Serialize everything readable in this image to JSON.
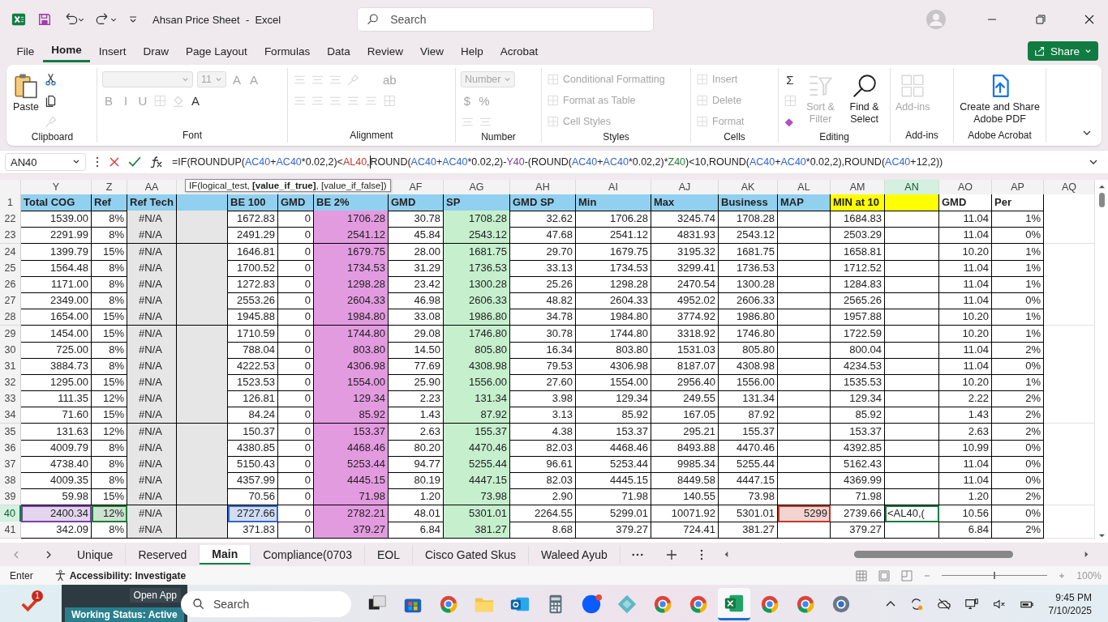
{
  "window": {
    "title": "Ahsan Price Sheet  -  Excel"
  },
  "search": {
    "placeholder": "Search"
  },
  "share": {
    "label": "Share"
  },
  "menu": [
    {
      "label": "File",
      "selected": false
    },
    {
      "label": "Home",
      "selected": true
    },
    {
      "label": "Insert",
      "selected": false
    },
    {
      "label": "Draw",
      "selected": false
    },
    {
      "label": "Page Layout",
      "selected": false
    },
    {
      "label": "Formulas",
      "selected": false
    },
    {
      "label": "Data",
      "selected": false
    },
    {
      "label": "Review",
      "selected": false
    },
    {
      "label": "View",
      "selected": false
    },
    {
      "label": "Help",
      "selected": false
    },
    {
      "label": "Acrobat",
      "selected": false
    }
  ],
  "ribbon": {
    "groups": [
      {
        "label": "Clipboard",
        "blocks": [
          {
            "kind": "clipboard",
            "label": "Paste",
            "disabled": false
          },
          {
            "kind": "stack",
            "lines": [
              [
                {
                  "kind": "scissors",
                  "disabled": false
                }
              ],
              [
                {
                  "kind": "pages",
                  "disabled": false
                }
              ],
              [
                {
                  "kind": "brush",
                  "disabled": true
                }
              ]
            ]
          }
        ]
      },
      {
        "label": "Font",
        "blocks": [
          {
            "kind": "stack",
            "lines": [
              [
                {
                  "kind": "field",
                  "disabled": true
                },
                {
                  "kind": "field",
                  "value": "11",
                  "disabled": true
                },
                {
                  "kind": "glyph",
                  "label": "A",
                  "disabled": true
                },
                {
                  "kind": "glyph",
                  "label": "A",
                  "disabled": true
                }
              ],
              [
                {
                  "kind": "glyph",
                  "label": "B",
                  "disabled": true
                },
                {
                  "kind": "glyph",
                  "label": "I",
                  "disabled": true
                },
                {
                  "kind": "glyph",
                  "label": "U",
                  "disabled": true
                },
                {
                  "kind": "grid",
                  "disabled": true
                },
                {
                  "kind": "bucket",
                  "disabled": true
                },
                {
                  "kind": "glyph",
                  "label": "A",
                  "disabled": false
                }
              ]
            ]
          }
        ]
      },
      {
        "label": "Alignment",
        "blocks": [
          {
            "kind": "stack",
            "lines": [
              [
                {
                  "kind": "lines",
                  "disabled": true
                },
                {
                  "kind": "lines",
                  "disabled": true
                },
                {
                  "kind": "lines",
                  "disabled": true
                },
                {
                  "kind": "brush",
                  "disabled": true
                }
              ],
              [
                {
                  "kind": "lines",
                  "disabled": true
                },
                {
                  "kind": "lines",
                  "disabled": true
                },
                {
                  "kind": "lines",
                  "disabled": true
                },
                {
                  "kind": "lines",
                  "disabled": true
                },
                {
                  "kind": "lines",
                  "disabled": true
                }
              ]
            ]
          },
          {
            "kind": "stack",
            "lines": [
              [
                {
                  "kind": "glyph",
                  "label": "ab",
                  "disabled": true
                }
              ],
              [
                {
                  "kind": "grid",
                  "disabled": true
                }
              ]
            ]
          }
        ]
      },
      {
        "label": "Number",
        "blocks": [
          {
            "kind": "stack",
            "lines": [
              [
                {
                  "kind": "field",
                  "value": "Number",
                  "disabled": true
                }
              ],
              [
                {
                  "kind": "glyph",
                  "label": "$",
                  "disabled": true
                },
                {
                  "kind": "glyph",
                  "label": "%",
                  "disabled": true
                }
              ],
              [
                {
                  "kind": "lines",
                  "disabled": true
                },
                {
                  "kind": "lines",
                  "disabled": true
                }
              ]
            ]
          }
        ]
      },
      {
        "label": "Styles",
        "blocks": [
          {
            "kind": "stack",
            "lines": [
              [
                {
                  "kind": "small",
                  "label": "Conditional Formatting",
                  "disabled": true
                }
              ],
              [
                {
                  "kind": "small",
                  "label": "Format as Table",
                  "disabled": true
                }
              ],
              [
                {
                  "kind": "small",
                  "label": "Cell Styles",
                  "disabled": true
                }
              ]
            ]
          }
        ]
      },
      {
        "label": "Cells",
        "blocks": [
          {
            "kind": "stack",
            "lines": [
              [
                {
                  "kind": "small",
                  "label": "Insert",
                  "disabled": true
                }
              ],
              [
                {
                  "kind": "small",
                  "label": "Delete",
                  "disabled": true
                }
              ],
              [
                {
                  "kind": "small",
                  "label": "Format",
                  "disabled": true
                }
              ]
            ]
          }
        ]
      },
      {
        "label": "Editing",
        "blocks": [
          {
            "kind": "stack",
            "lines": [
              [
                {
                  "kind": "glyph",
                  "label": "Σ",
                  "disabled": false
                }
              ],
              [
                {
                  "kind": "grid",
                  "disabled": true
                }
              ],
              [
                {
                  "kind": "diamond",
                  "disabled": false
                }
              ]
            ]
          },
          {
            "kind": "funnel",
            "label": "Sort & Filter",
            "disabled": true
          },
          {
            "kind": "magnifier",
            "label": "Find & Select",
            "disabled": false
          }
        ]
      },
      {
        "label": "Add-ins",
        "blocks": [
          {
            "kind": "tiles",
            "label": "Add-ins",
            "disabled": true
          }
        ]
      },
      {
        "label": "Adobe Acrobat",
        "blocks": [
          {
            "kind": "pdf",
            "label": "Create and Share Adobe PDF",
            "disabled": false
          }
        ]
      }
    ]
  },
  "formula_bar": {
    "name_box": "AN40",
    "segments": [
      {
        "text": "=IF(ROUNDUP("
      },
      {
        "text": "AC40",
        "color": "#3366cc"
      },
      {
        "text": "+"
      },
      {
        "text": "AC40",
        "color": "#3366cc"
      },
      {
        "text": "*0.02,2)<"
      },
      {
        "text": "AL40",
        "color": "#c0392b"
      },
      {
        "text": ","
      },
      {
        "kind": "cursor"
      },
      {
        "text": "ROUND("
      },
      {
        "text": "AC40",
        "color": "#3366cc"
      },
      {
        "text": "+"
      },
      {
        "text": "AC40",
        "color": "#3366cc"
      },
      {
        "text": "*0.02,2)-"
      },
      {
        "text": "Y40",
        "color": "#7b3fa8"
      },
      {
        "text": "-(ROUND("
      },
      {
        "text": "AC40",
        "color": "#3366cc"
      },
      {
        "text": "+"
      },
      {
        "text": "AC40",
        "color": "#3366cc"
      },
      {
        "text": "*0.02,2)*"
      },
      {
        "text": "Z40",
        "color": "#1e7b34"
      },
      {
        "text": ")<10,ROUND("
      },
      {
        "text": "AC40",
        "color": "#3366cc"
      },
      {
        "text": "+"
      },
      {
        "text": "AC40",
        "color": "#3366cc"
      },
      {
        "text": "*0.02,2),ROUND("
      },
      {
        "text": "AC40",
        "color": "#3366cc"
      },
      {
        "text": "+12,2))"
      }
    ],
    "tooltip": "IF(logical_test, **[value_if_true]**, [value_if_false])"
  },
  "sheet": {
    "header_row_number": "1",
    "columns": [
      {
        "letter": "Y",
        "header": {
          "text": "Total COG",
          "color": "#92d0f0"
        },
        "selected": false
      },
      {
        "letter": "Z",
        "header": {
          "text": "Ref",
          "color": "#92d0f0"
        },
        "selected": false
      },
      {
        "letter": "AA",
        "header": {
          "text": "Ref Tech",
          "color": "#92d0f0"
        },
        "color": "#e6e6e6",
        "kind": "label",
        "selected": false
      },
      {
        "header": {
          "color": "#92d0f0"
        },
        "color": "#e6e6e6"
      },
      {
        "header": {
          "text": "BE 100",
          "color": "#92d0f0"
        }
      },
      {
        "header": {
          "text": "GMD",
          "color": "#92d0f0"
        }
      },
      {
        "header": {
          "text": "BE 2%",
          "color": "#92d0f0"
        },
        "color": "#e39be0"
      },
      {
        "letter": "AF",
        "header": {
          "text": "GMD",
          "color": "#92d0f0"
        },
        "selected": false
      },
      {
        "letter": "AG",
        "header": {
          "text": "SP",
          "color": "#92d0f0"
        },
        "color": "#c6efce",
        "selected": false
      },
      {
        "letter": "AH",
        "header": {
          "text": "GMD SP",
          "color": "#92d0f0"
        },
        "selected": false
      },
      {
        "letter": "AI",
        "header": {
          "text": "Min",
          "color": "#92d0f0"
        },
        "selected": false
      },
      {
        "letter": "AJ",
        "header": {
          "text": "Max",
          "color": "#92d0f0"
        },
        "selected": false
      },
      {
        "letter": "AK",
        "header": {
          "text": "Business",
          "color": "#92d0f0"
        },
        "selected": false
      },
      {
        "letter": "AL",
        "header": {
          "text": "MAP",
          "color": "#92d0f0"
        },
        "selected": false
      },
      {
        "letter": "AM",
        "header": {
          "text": "MIN at 10",
          "color": "#ffff00"
        },
        "selected": false
      },
      {
        "letter": "AN",
        "header": {
          "color": "#ffff00"
        },
        "selected": true
      },
      {
        "letter": "AO",
        "header": {
          "text": "GMD",
          "color": "#ffffff"
        },
        "selected": false
      },
      {
        "letter": "AP",
        "header": {
          "text": "Per",
          "color": "#ffffff"
        },
        "selected": false
      },
      {
        "letter": "AQ",
        "header": {
          "color": "#ffffff"
        },
        "selected": false
      }
    ],
    "rows": [
      {
        "number": "22",
        "selected": false,
        "cells": [
          "1539.00",
          "8%",
          "#N/A",
          null,
          "1672.83",
          "0",
          "1706.28",
          "30.78",
          "1708.28",
          "32.62",
          "1706.28",
          "3245.74",
          "1708.28",
          null,
          "1684.83",
          null,
          "11.04",
          "1%"
        ]
      },
      {
        "number": "23",
        "selected": false,
        "cells": [
          "2291.99",
          "8%",
          "#N/A",
          null,
          "2491.29",
          "0",
          "2541.12",
          "45.84",
          "2543.12",
          "47.68",
          "2541.12",
          "4831.93",
          "2543.12",
          null,
          "2503.29",
          null,
          "11.04",
          "0%"
        ]
      },
      {
        "number": "24",
        "selected": false,
        "cells": [
          "1399.79",
          "15%",
          "#N/A",
          null,
          "1646.81",
          "0",
          "1679.75",
          "28.00",
          "1681.75",
          "29.70",
          "1679.75",
          "3195.32",
          "1681.75",
          null,
          "1658.81",
          null,
          "10.20",
          "1%"
        ]
      },
      {
        "number": "25",
        "selected": false,
        "cells": [
          "1564.48",
          "8%",
          "#N/A",
          null,
          "1700.52",
          "0",
          "1734.53",
          "31.29",
          "1736.53",
          "33.13",
          "1734.53",
          "3299.41",
          "1736.53",
          null,
          "1712.52",
          null,
          "11.04",
          "1%"
        ]
      },
      {
        "number": "26",
        "selected": false,
        "cells": [
          "1171.00",
          "8%",
          "#N/A",
          null,
          "1272.83",
          "0",
          "1298.28",
          "23.42",
          "1300.28",
          "25.26",
          "1298.28",
          "2470.54",
          "1300.28",
          null,
          "1284.83",
          null,
          "11.04",
          "1%"
        ]
      },
      {
        "number": "27",
        "selected": false,
        "cells": [
          "2349.00",
          "8%",
          "#N/A",
          null,
          "2553.26",
          "0",
          "2604.33",
          "46.98",
          "2606.33",
          "48.82",
          "2604.33",
          "4952.02",
          "2606.33",
          null,
          "2565.26",
          null,
          "11.04",
          "0%"
        ]
      },
      {
        "number": "28",
        "selected": false,
        "cells": [
          "1654.00",
          "15%",
          "#N/A",
          null,
          "1945.88",
          "0",
          "1984.80",
          "33.08",
          "1986.80",
          "34.78",
          "1984.80",
          "3774.92",
          "1986.80",
          null,
          "1957.88",
          null,
          "10.20",
          "1%"
        ]
      },
      {
        "number": "29",
        "selected": false,
        "cells": [
          "1454.00",
          "15%",
          "#N/A",
          null,
          "1710.59",
          "0",
          "1744.80",
          "29.08",
          "1746.80",
          "30.78",
          "1744.80",
          "3318.92",
          "1746.80",
          null,
          "1722.59",
          null,
          "10.20",
          "1%"
        ]
      },
      {
        "number": "30",
        "selected": false,
        "cells": [
          "725.00",
          "8%",
          "#N/A",
          null,
          "788.04",
          "0",
          "803.80",
          "14.50",
          "805.80",
          "16.34",
          "803.80",
          "1531.03",
          "805.80",
          null,
          "800.04",
          null,
          "11.04",
          "2%"
        ]
      },
      {
        "number": "31",
        "selected": false,
        "cells": [
          "3884.73",
          "8%",
          "#N/A",
          null,
          "4222.53",
          "0",
          "4306.98",
          "77.69",
          "4308.98",
          "79.53",
          "4306.98",
          "8187.07",
          "4308.98",
          null,
          "4234.53",
          null,
          "11.04",
          "0%"
        ]
      },
      {
        "number": "32",
        "selected": false,
        "cells": [
          "1295.00",
          "15%",
          "#N/A",
          null,
          "1523.53",
          "0",
          "1554.00",
          "25.90",
          "1556.00",
          "27.60",
          "1554.00",
          "2956.40",
          "1556.00",
          null,
          "1535.53",
          null,
          "10.20",
          "1%"
        ]
      },
      {
        "number": "33",
        "selected": false,
        "cells": [
          "111.35",
          "12%",
          "#N/A",
          null,
          "126.81",
          "0",
          "129.34",
          "2.23",
          "131.34",
          "3.98",
          "129.34",
          "249.55",
          "131.34",
          null,
          "129.34",
          null,
          "2.22",
          "2%"
        ]
      },
      {
        "number": "34",
        "selected": false,
        "cells": [
          "71.60",
          "15%",
          "#N/A",
          null,
          "84.24",
          "0",
          "85.92",
          "1.43",
          "87.92",
          "3.13",
          "85.92",
          "167.05",
          "87.92",
          null,
          "85.92",
          null,
          "1.43",
          "2%"
        ]
      },
      {
        "number": "35",
        "selected": false,
        "cells": [
          "131.63",
          "12%",
          "#N/A",
          null,
          "150.37",
          "0",
          "153.37",
          "2.63",
          "155.37",
          "4.38",
          "153.37",
          "295.21",
          "155.37",
          null,
          "153.37",
          null,
          "2.63",
          "2%"
        ]
      },
      {
        "number": "36",
        "selected": false,
        "cells": [
          "4009.79",
          "8%",
          "#N/A",
          null,
          "4380.85",
          "0",
          "4468.46",
          "80.20",
          "4470.46",
          "82.03",
          "4468.46",
          "8493.88",
          "4470.46",
          null,
          "4392.85",
          null,
          "10.99",
          "0%"
        ]
      },
      {
        "number": "37",
        "selected": false,
        "cells": [
          "4738.40",
          "8%",
          "#N/A",
          null,
          "5150.43",
          "0",
          "5253.44",
          "94.77",
          "5255.44",
          "96.61",
          "5253.44",
          "9985.34",
          "5255.44",
          null,
          "5162.43",
          null,
          "11.04",
          "0%"
        ]
      },
      {
        "number": "38",
        "selected": false,
        "cells": [
          "4009.35",
          "8%",
          "#N/A",
          null,
          "4357.99",
          "0",
          "4445.15",
          "80.19",
          "4447.15",
          "82.03",
          "4445.15",
          "8449.58",
          "4447.15",
          null,
          "4369.99",
          null,
          "11.04",
          "0%"
        ]
      },
      {
        "number": "39",
        "selected": false,
        "cells": [
          "59.98",
          "15%",
          "#N/A",
          null,
          "70.56",
          "0",
          "71.98",
          "1.20",
          "73.98",
          "2.90",
          "71.98",
          "140.55",
          "73.98",
          null,
          "71.98",
          null,
          "1.20",
          "2%"
        ]
      },
      {
        "number": "40",
        "selected": true,
        "cells": [
          {
            "text": "2400.34",
            "color": "#7b3fa8"
          },
          {
            "text": "12%",
            "color": "#1e7b34"
          },
          "#N/A",
          null,
          {
            "text": "2727.66",
            "color": "#3366cc"
          },
          "0",
          "2782.21",
          "48.01",
          "5301.01",
          "2264.55",
          "5299.01",
          "10071.92",
          "5301.01",
          {
            "text": "5299",
            "color": "#c0392b"
          },
          "2739.66",
          {
            "text": "<AL40,(",
            "active": true
          },
          "10.56",
          "0%"
        ]
      },
      {
        "number": "41",
        "selected": false,
        "cells": [
          "342.09",
          "8%",
          "#N/A",
          null,
          "371.83",
          "0",
          "379.27",
          "6.84",
          "381.27",
          "8.68",
          "379.27",
          "724.41",
          "381.27",
          null,
          "379.27",
          null,
          "6.84",
          "2%"
        ]
      }
    ]
  },
  "sheet_tabs": [
    {
      "label": "Unique",
      "selected": false
    },
    {
      "label": "Reserved",
      "selected": false
    },
    {
      "label": "Main",
      "selected": true
    },
    {
      "label": "Compliance(0703",
      "selected": false
    },
    {
      "label": "EOL",
      "selected": false
    },
    {
      "label": "Cisco Gated Skus",
      "selected": false
    },
    {
      "label": "Waleed Ayub",
      "selected": false
    }
  ],
  "status_bar": {
    "mode": "Enter",
    "accessibility": "Accessibility: Investigate",
    "zoom": "100%",
    "zoom_slider": {
      "level": 0.5
    }
  },
  "taskbar": {
    "badge": "1",
    "widget": {
      "button": "Open App",
      "status": "Working Status: Active"
    },
    "search_placeholder": "Search",
    "apps": [
      {
        "kind": "tasks",
        "selected": false
      },
      {
        "kind": "store",
        "selected": false
      },
      {
        "kind": "browser",
        "selected": false
      },
      {
        "kind": "folder",
        "selected": false
      },
      {
        "kind": "mail",
        "selected": false
      },
      {
        "kind": "calculator",
        "selected": false
      },
      {
        "kind": "meeting",
        "selected": false
      },
      {
        "kind": "gem",
        "selected": false
      },
      {
        "kind": "browser",
        "selected": false
      },
      {
        "kind": "browser",
        "selected": false
      },
      {
        "kind": "sheet",
        "selected": true
      },
      {
        "kind": "browser",
        "selected": false
      },
      {
        "kind": "browser",
        "selected": false
      },
      {
        "kind": "gear",
        "selected": false
      }
    ],
    "time": "9:45 PM",
    "date": "7/10/2025"
  }
}
